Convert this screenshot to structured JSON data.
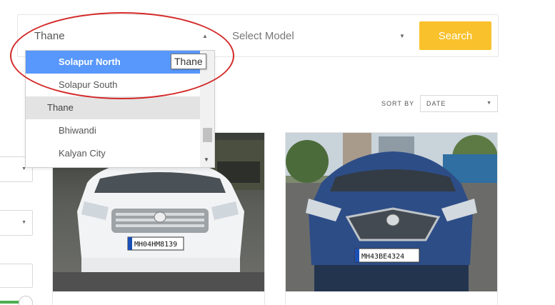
{
  "search": {
    "city_value": "Thane",
    "model_placeholder": "Select Model",
    "button_label": "Search"
  },
  "dropdown": {
    "items": [
      {
        "label": "Solapur North",
        "type": "child",
        "state": "highlighted"
      },
      {
        "label": "Solapur South",
        "type": "child"
      },
      {
        "label": "Thane",
        "type": "group"
      },
      {
        "label": "Bhiwandi",
        "type": "child"
      },
      {
        "label": "Kalyan City",
        "type": "child"
      }
    ],
    "tooltip": "Thane"
  },
  "sort": {
    "label": "SORT BY",
    "value": "DATE"
  },
  "cards": [
    {
      "car": "white sedan",
      "plate": "MH04HM8139"
    },
    {
      "car": "blue hatchback",
      "plate": "MH43BE4324"
    }
  ],
  "colors": {
    "accent": "#f9c12b",
    "highlight": "#5897fb",
    "annotation": "#d42929",
    "slider": "#4caf50"
  }
}
